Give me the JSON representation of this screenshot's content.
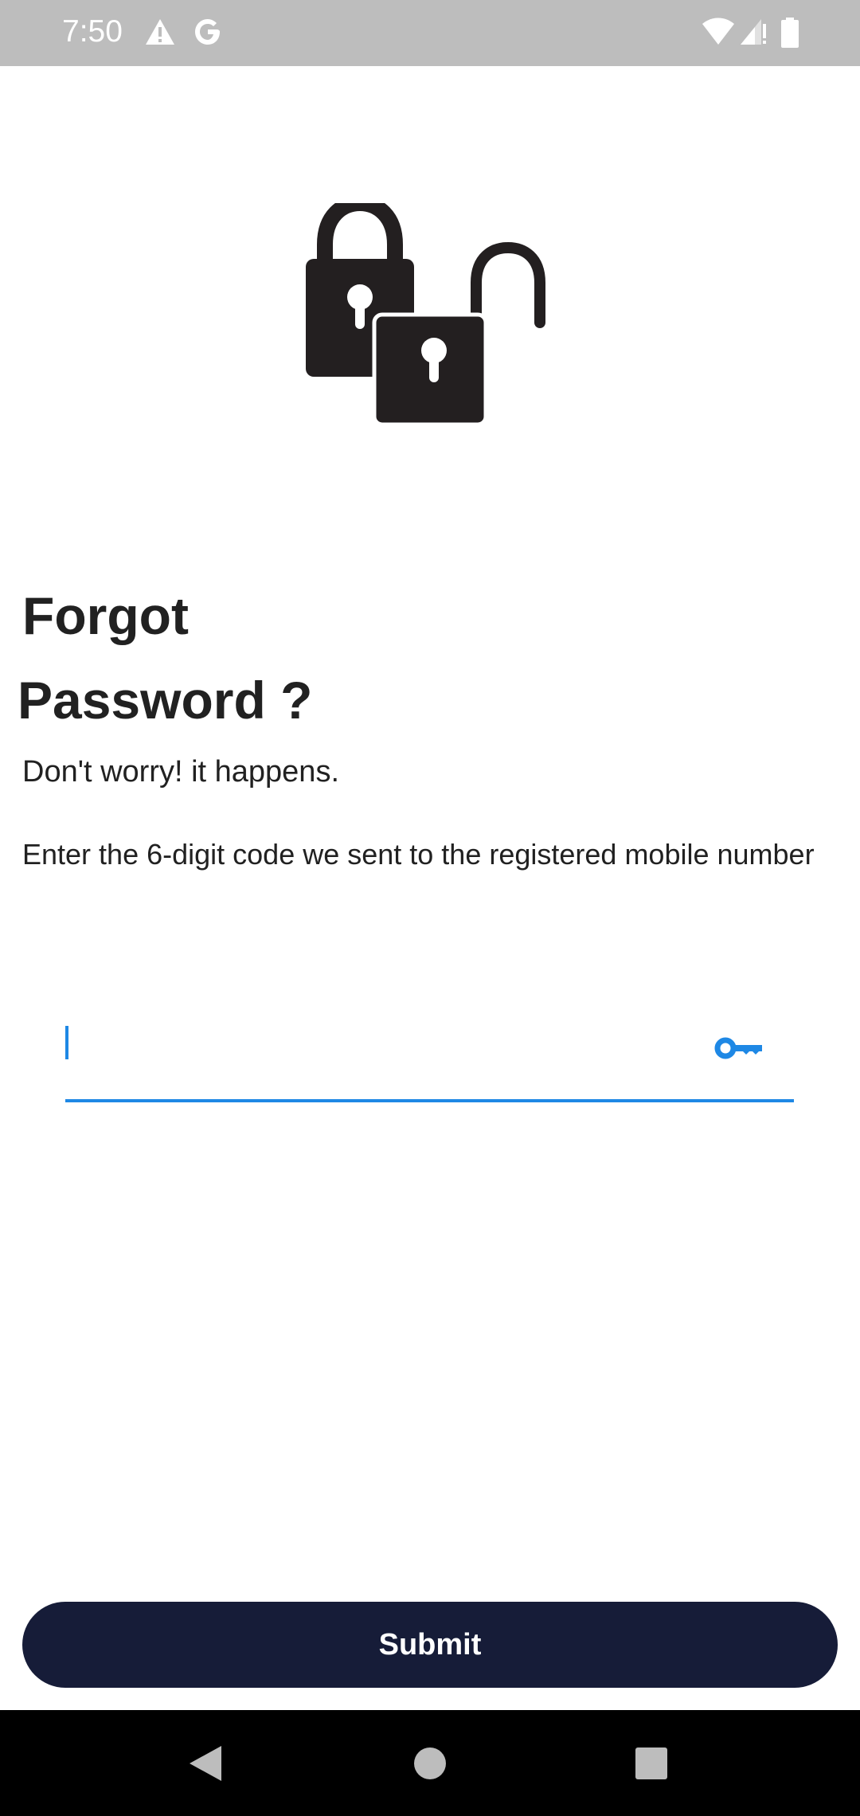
{
  "status_bar": {
    "time": "7:50",
    "left_icons": [
      "alert-icon",
      "google-icon"
    ],
    "right_icons": [
      "wifi-icon",
      "cellular-icon",
      "battery-icon"
    ]
  },
  "illustration": {
    "icon": "padlocks-icon"
  },
  "title": {
    "line1": "Forgot",
    "line2": "Password  ?"
  },
  "subtitle": "Don't worry! it happens.",
  "instructions": "Enter the 6-digit code we sent to the registered mobile number",
  "code_input": {
    "value": "",
    "placeholder": "",
    "icon": "key-icon",
    "accent_color": "#1e88e5"
  },
  "submit": {
    "label": "Submit",
    "background": "#161c38"
  },
  "nav_bar": {
    "buttons": [
      "back-icon",
      "home-icon",
      "recents-icon"
    ]
  }
}
